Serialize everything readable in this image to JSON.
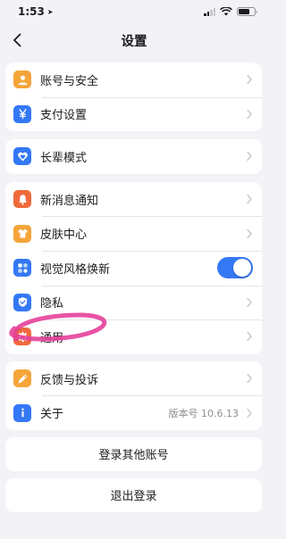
{
  "status": {
    "time": "1:53"
  },
  "nav": {
    "title": "设置"
  },
  "groups": {
    "account": [
      {
        "label": "账号与安全",
        "icon": "person-icon",
        "color": "#f5a53a"
      },
      {
        "label": "支付设置",
        "icon": "yen-icon",
        "color": "#3478f6"
      }
    ],
    "elder": [
      {
        "label": "长辈模式",
        "icon": "heart-shield-icon",
        "color": "#3478f6"
      }
    ],
    "general": [
      {
        "label": "新消息通知",
        "icon": "bell-icon",
        "color": "#ef6a3b"
      },
      {
        "label": "皮肤中心",
        "icon": "shirt-icon",
        "color": "#f5a53a"
      },
      {
        "label": "视觉风格焕新",
        "icon": "grid-icon",
        "color": "#3478f6",
        "toggle": true
      },
      {
        "label": "隐私",
        "icon": "shield-check-icon",
        "color": "#3478f6"
      },
      {
        "label": "通用",
        "icon": "gear-icon",
        "color": "#ef6a3b"
      }
    ],
    "about": [
      {
        "label": "反馈与投诉",
        "icon": "pencil-icon",
        "color": "#f5a53a"
      },
      {
        "label": "关于",
        "icon": "info-icon",
        "color": "#3478f6",
        "value": "版本号 10.6.13"
      }
    ]
  },
  "buttons": {
    "switch_account": "登录其他账号",
    "logout": "退出登录"
  },
  "colors": {
    "accent": "#3478f6",
    "annotation": "#e5409a"
  }
}
